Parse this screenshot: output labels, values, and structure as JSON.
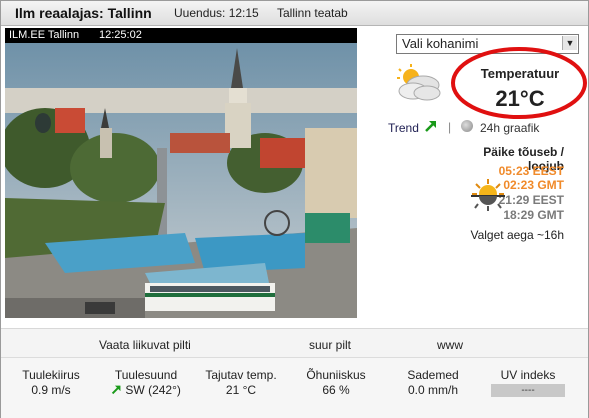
{
  "header": {
    "title": "Ilm reaalajas: Tallinn",
    "updated": "Uuendus: 12:15",
    "report": "Tallinn teatab"
  },
  "camera": {
    "label": "ILM.EE Tallinn",
    "time": "12:25:02"
  },
  "location_select": {
    "value": "Vali kohanimi"
  },
  "temperature": {
    "label": "Temperatuur",
    "value": "21°C"
  },
  "trend": {
    "label": "Trend",
    "separator": "|",
    "graph_link": "24h graafik"
  },
  "sun": {
    "title": "Päike tõuseb / loojub",
    "rise_local": "05:23 EEST",
    "rise_gmt": "02:23 GMT",
    "set_local": "21:29 EEST",
    "set_gmt": "18:29 GMT",
    "daylight": "Valget aega ~16h"
  },
  "links": {
    "moving": "Vaata liikuvat pilti",
    "big": "suur pilt",
    "www": "www"
  },
  "stats": [
    {
      "label": "Tuulekiirus",
      "value": "0.9 m/s"
    },
    {
      "label": "Tuulesuund",
      "value": "SW (242°)"
    },
    {
      "label": "Tajutav temp.",
      "value": "21 °C"
    },
    {
      "label": "Õhuniiskus",
      "value": "66 %"
    },
    {
      "label": "Sademed",
      "value": "0.0 mm/h"
    },
    {
      "label": "UV indeks",
      "value": "----"
    }
  ],
  "colors": {
    "sunrise": "#f08a2a",
    "sunset": "#7a7a7a",
    "highlight_ellipse": "#e01010",
    "trend_up": "#1a9a1a"
  },
  "icons": {
    "weather": "partly-cloudy-icon",
    "trend": "arrow-up-right-icon",
    "graph": "graph-icon",
    "sun": "sunrise-sunset-icon",
    "wind_direction": "arrow-up-right-icon"
  }
}
